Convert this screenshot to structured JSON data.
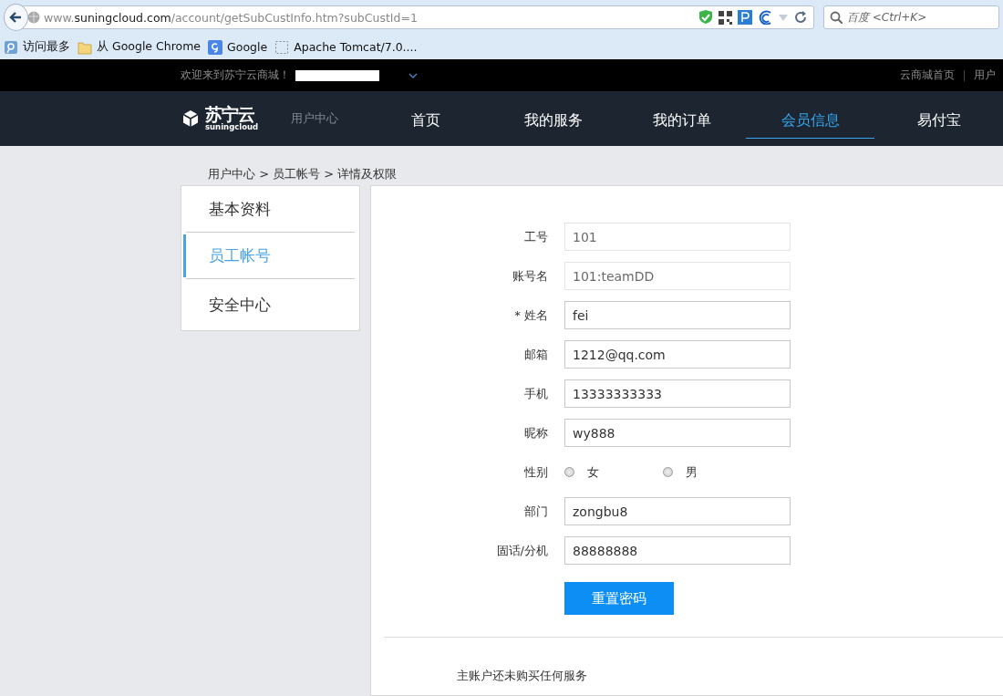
{
  "browser": {
    "url": "www.**suningcloud.com**/account/getSubCustInfo.htm?subCustId=1",
    "search": {
      "placeholder": "百度 <Ctrl+K>"
    },
    "bookmarks": [
      {
        "kind": "most",
        "label": "访问最多"
      },
      {
        "kind": "folder",
        "label": "从 Google Chrome"
      },
      {
        "kind": "google",
        "label": "Google"
      },
      {
        "kind": "page",
        "label": "Apache Tomcat/7.0...."
      }
    ]
  },
  "top_bar": {
    "welcome": "欢迎来到苏宁云商城！",
    "links": [
      "云商城首页",
      "用户"
    ]
  },
  "header": {
    "logo": {
      "name": "苏宁云",
      "sub": "suningcloud"
    },
    "section": "用户中心",
    "nav": [
      {
        "label": "首页",
        "selected": false
      },
      {
        "label": "我的服务",
        "selected": false
      },
      {
        "label": "我的订单",
        "selected": false
      },
      {
        "label": "会员信息",
        "selected": true
      },
      {
        "label": "易付宝",
        "selected": false
      }
    ]
  },
  "breadcrumb": "用户中心 > 员工帐号 > 详情及权限",
  "sidebar": {
    "items": [
      {
        "label": "基本资料",
        "selected": false
      },
      {
        "label": "员工帐号",
        "selected": true
      },
      {
        "label": "安全中心",
        "selected": false
      }
    ]
  },
  "form": {
    "fields": [
      {
        "kind": "text",
        "label": "工号",
        "value": "101",
        "disabled": true
      },
      {
        "kind": "text",
        "label": "账号名",
        "value": "101:teamDD",
        "disabled": true
      },
      {
        "kind": "text",
        "label": "* 姓名",
        "value": "fei",
        "disabled": false
      },
      {
        "kind": "text",
        "label": "邮箱",
        "value": "1212@qq.com",
        "disabled": false
      },
      {
        "kind": "text",
        "label": "手机",
        "value": "13333333333",
        "disabled": false
      },
      {
        "kind": "text",
        "label": "昵称",
        "value": "wy888",
        "disabled": false
      },
      {
        "kind": "radio",
        "label": "性别",
        "options": [
          {
            "label": "女",
            "selected": false
          },
          {
            "label": "男",
            "selected": false
          }
        ]
      },
      {
        "kind": "text",
        "label": "部门",
        "value": "zongbu8",
        "disabled": false
      },
      {
        "kind": "text",
        "label": "固话/分机",
        "value": "88888888",
        "disabled": false
      }
    ],
    "button": "重置密码"
  },
  "services_note": "主账户还未购买任何服务"
}
